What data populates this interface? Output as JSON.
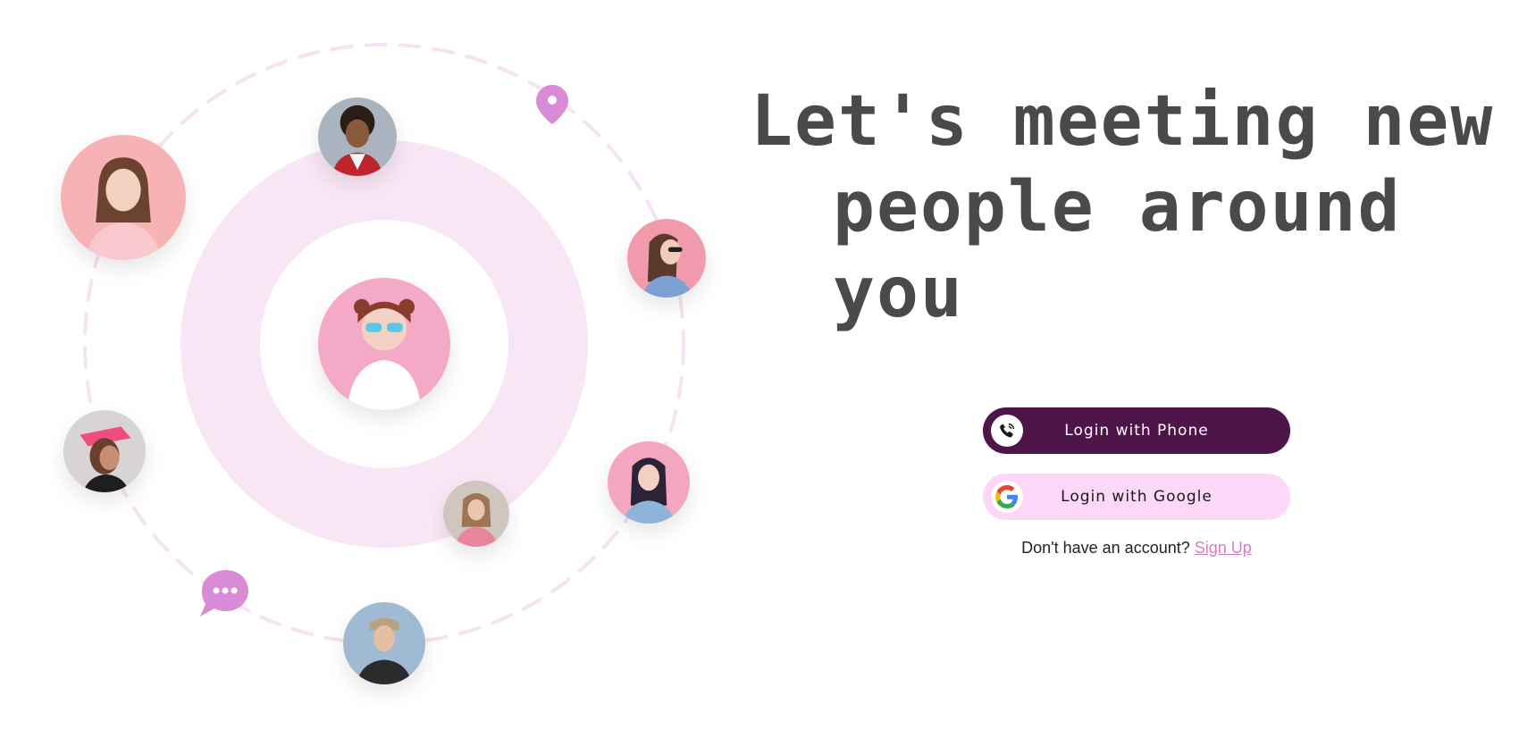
{
  "headline": {
    "line1": "Let's meeting new",
    "line2": "people around you"
  },
  "buttons": {
    "phone_label": "Login with Phone",
    "google_label": "Login with Google"
  },
  "signup": {
    "prompt": "Don't have an account?",
    "link_label": "Sign Up"
  },
  "colors": {
    "primary_dark": "#4d1548",
    "primary_light": "#fcd7f7",
    "accent": "#d47cc8",
    "ring": "#f9e6f5",
    "headline": "#4a4a4a"
  },
  "icons": [
    "location-pin-icon",
    "chat-bubble-icon",
    "phone-icon",
    "google-icon"
  ]
}
